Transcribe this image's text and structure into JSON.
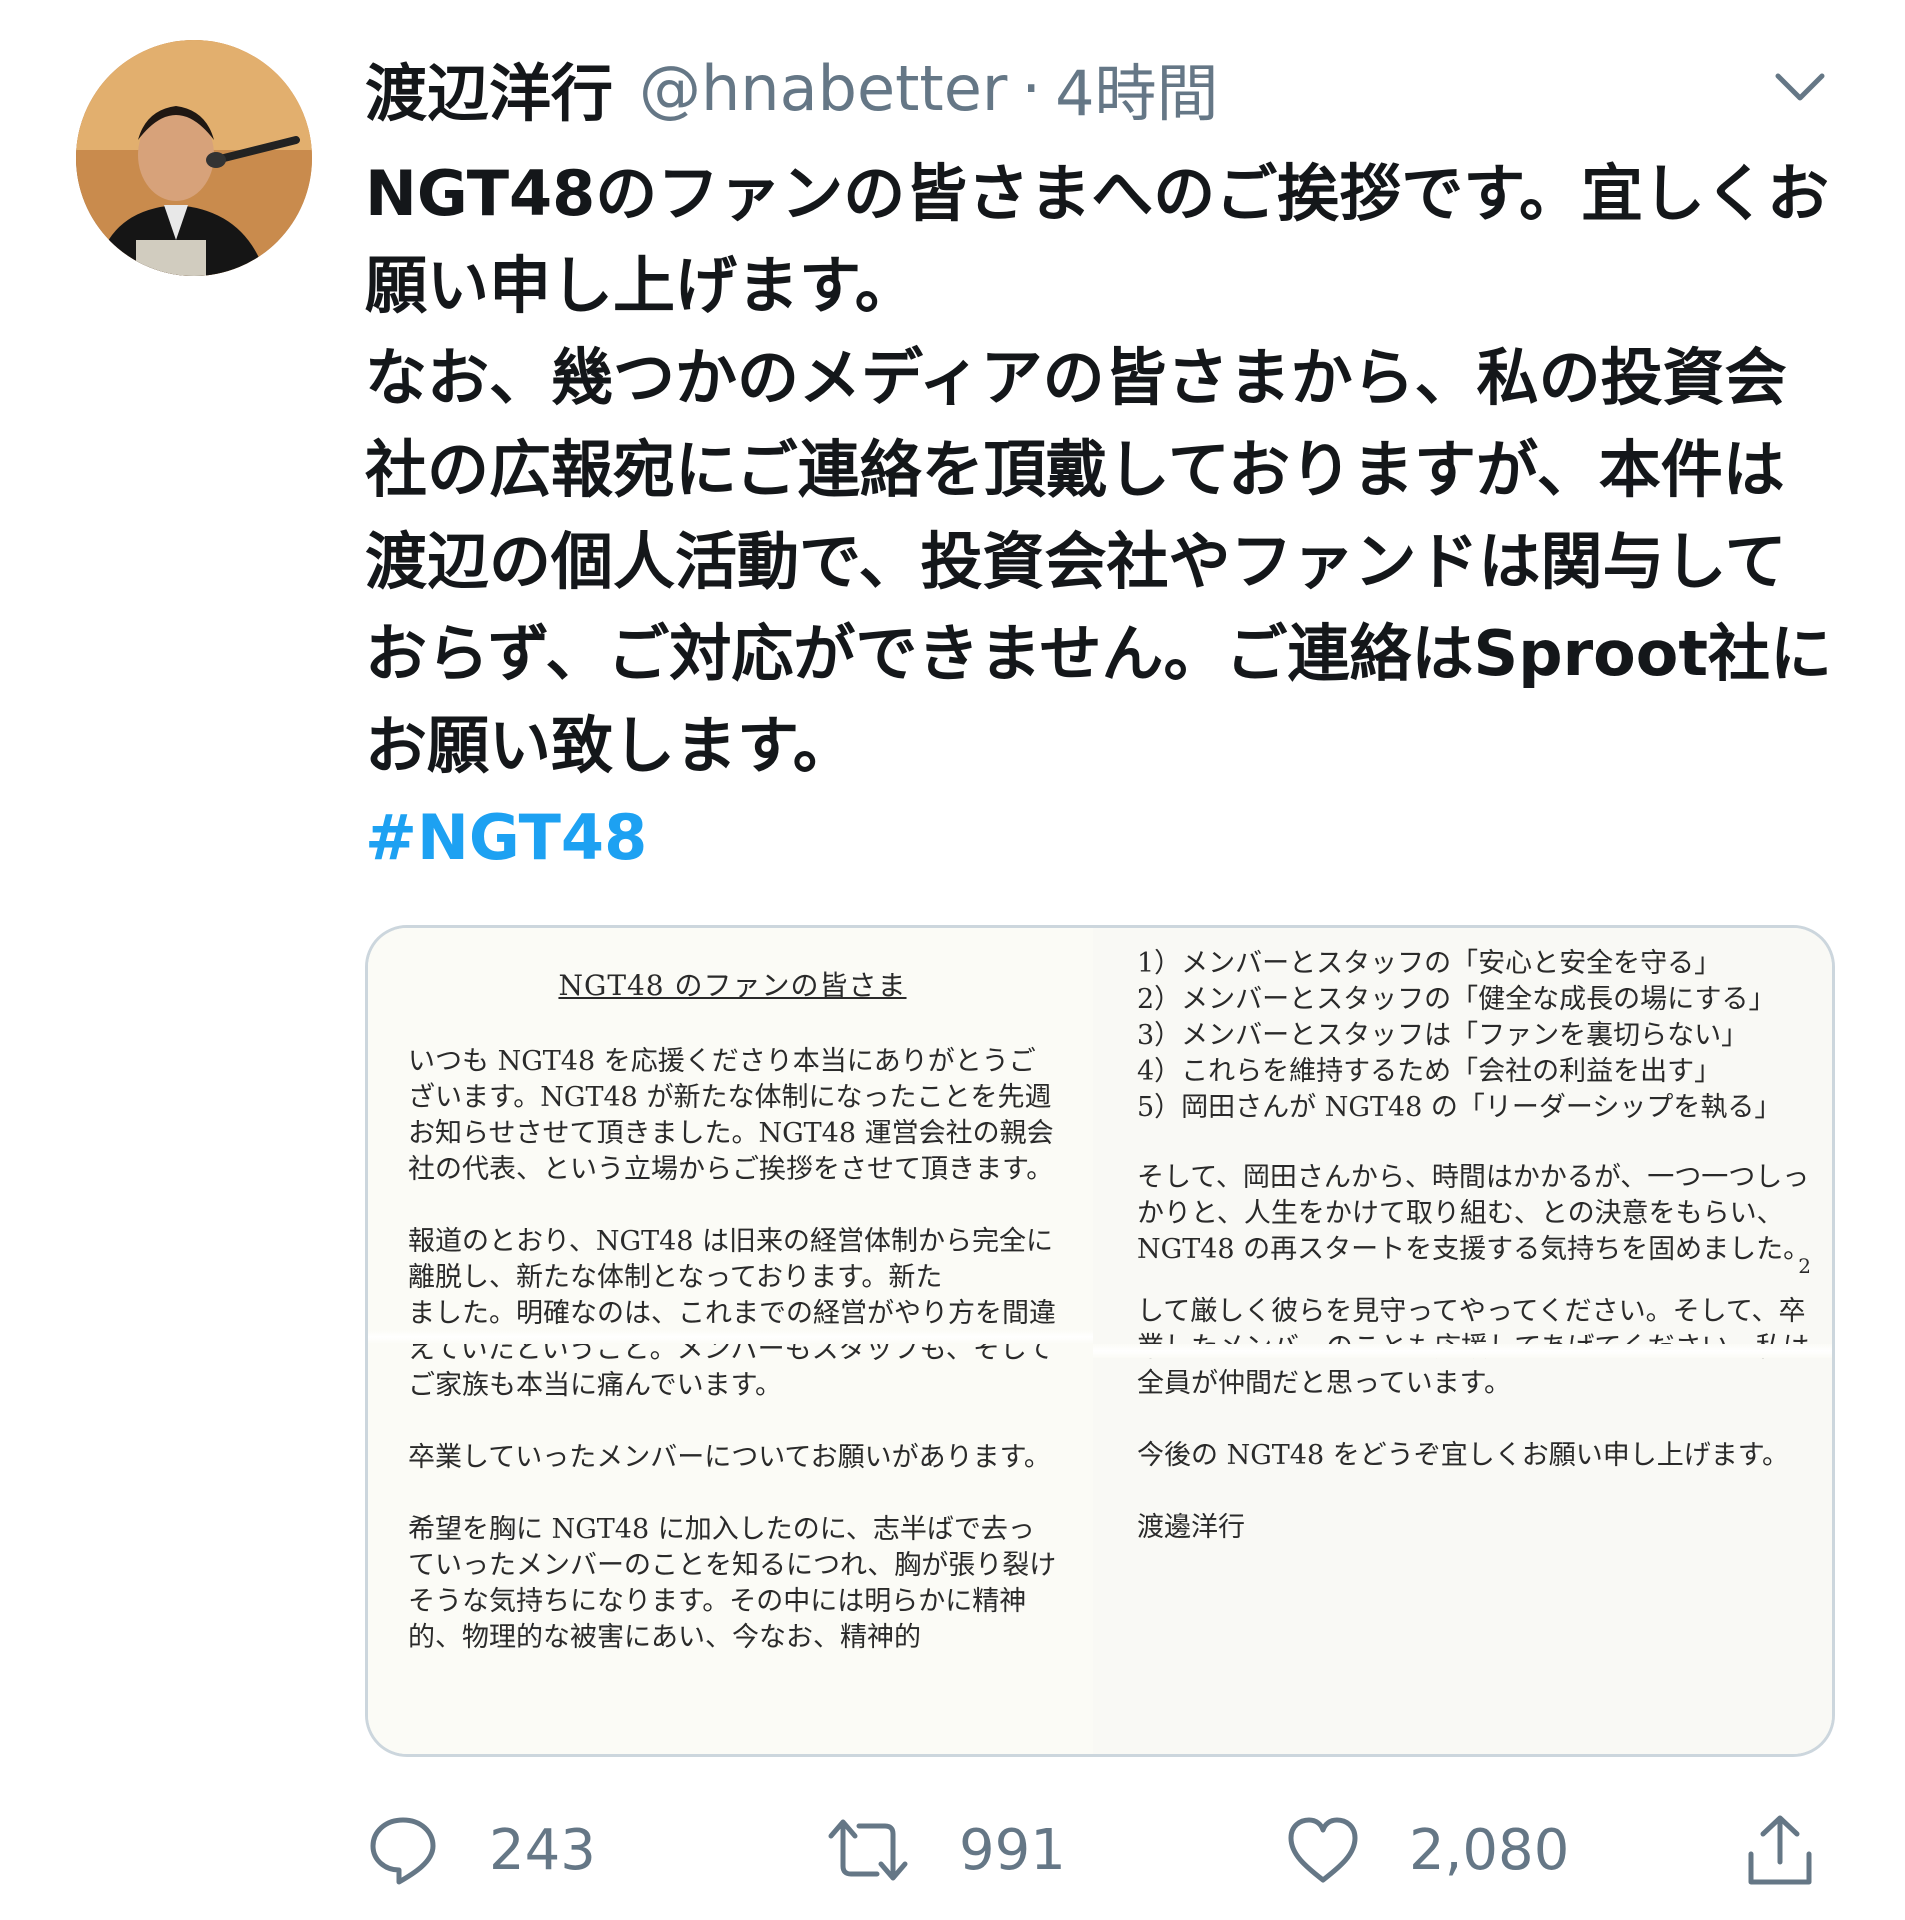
{
  "user": {
    "display_name": "渡辺洋行",
    "handle": "@hnabetter",
    "separator": "·",
    "time": "4時間"
  },
  "tweet": {
    "paragraph1": "NGT48のファンの皆さまへのご挨拶です。宜しくお願い申し上げます。",
    "paragraph2": "なお、幾つかのメディアの皆さまから、私の投資会社の広報宛にご連絡を頂戴しておりますが、本件は渡辺の個人活動で、投資会社やファンドは関与しておらず、ご対応ができません。ご連絡はSproot社にお願い致します。",
    "hashtag": "#NGT48"
  },
  "media": {
    "left_page": {
      "title": "NGT48 のファンの皆さま",
      "para1": "いつも NGT48 を応援くださり本当にありがとうございます。NGT48 が新たな体制になったことを先週お知らせさせて頂きました。NGT48 運営会社の親会社の代表、という立場からご挨拶をさせて頂きます。",
      "para2_top": "報道のとおり、NGT48 は旧来の経営体制から完全に離脱し、新たな体制となっております。新た",
      "para2_bottom": "ました。明確なのは、これまでの経営がやり方を間違えていたということ。メンバーもスタッフも、そしてご家族も本当に痛んでいます。",
      "para3": "卒業していったメンバーについてお願いがあります。",
      "para4": "希望を胸に NGT48 に加入したのに、志半ばで去っていったメンバーのことを知るにつれ、胸が張り裂けそうな気持ちになります。その中には明らかに精神的、物理的な被害にあい、今なお、精神的"
    },
    "right_page": {
      "list": [
        "1）メンバーとスタッフの「安心と安全を守る」",
        "2）メンバーとスタッフの「健全な成長の場にする」",
        "3）メンバーとスタッフは「ファンを裏切らない」",
        "4）これらを維持するため「会社の利益を出す」",
        "5）岡田さんが NGT48 の「リーダーシップを執る」"
      ],
      "para1": "そして、岡田さんから、時間はかかるが、一つ一つしっかりと、人生をかけて取り組む、との決意をもらい、NGT48 の再スタートを支援する気持ちを固めました。",
      "page_number": "2",
      "para2": "して厳しく彼らを見守ってやってください。そして、卒業したメンバーのことも応援してあげてください。私は全員が仲間だと思っています。",
      "para3": "今後の NGT48 をどうぞ宜しくお願い申し上げます。",
      "signature": "渡邊洋行"
    }
  },
  "actions": {
    "reply_count": "243",
    "retweet_count": "991",
    "like_count": "2,080"
  },
  "icons": {
    "reply": "reply-icon",
    "retweet": "retweet-icon",
    "like": "heart-icon",
    "share": "share-icon",
    "menu": "chevron-down-icon"
  },
  "colors": {
    "text": "#14171a",
    "secondary": "#657786",
    "hashtag": "#1da1f2",
    "border": "#ccd6dd"
  }
}
